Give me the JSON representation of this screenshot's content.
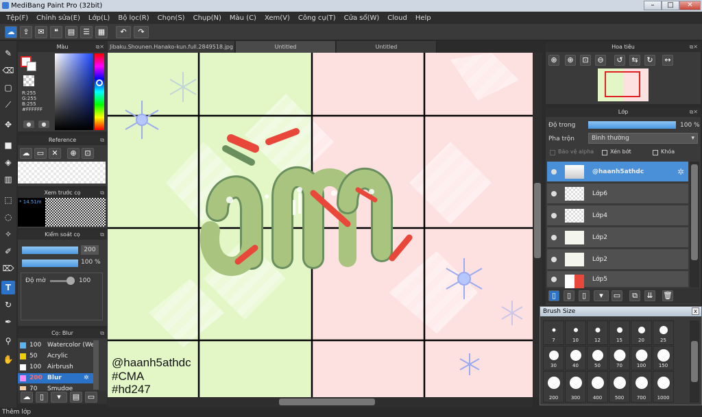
{
  "window": {
    "title": "MediBang Paint Pro (32bit)"
  },
  "menu": [
    "Tệp(F)",
    "Chỉnh sửa(E)",
    "Lớp(L)",
    "Bộ lọc(R)",
    "Chọn(S)",
    "Chụp(N)",
    "Màu (C)",
    "Xem(V)",
    "Công cụ(T)",
    "Cửa sổ(W)",
    "Cloud",
    "Help"
  ],
  "tabs": [
    "Jibaku.Shounen.Hanako-kun.full.2849518.jpg",
    "Untitled",
    "Untitled"
  ],
  "color_panel": {
    "title": "Màu",
    "r": "R:255",
    "g": "G:255",
    "b": "B:255",
    "hex": "#FFFFFF"
  },
  "reference_panel": {
    "title": "Reference"
  },
  "preview_panel": {
    "title": "Xem trước cọ",
    "size": "14.51m"
  },
  "brush_control": {
    "title": "Kiểm soát cọ",
    "size": "200",
    "opacity": "100 %",
    "blur_label": "Độ mờ",
    "blur_value": "100"
  },
  "brush_list": {
    "title": "Cọ: Blur",
    "items": [
      {
        "value": "100",
        "name": "Watercolor (We",
        "color": "#5ab4f0"
      },
      {
        "value": "50",
        "name": "Acrylic",
        "color": "#f0d000"
      },
      {
        "value": "100",
        "name": "Airbrush",
        "color": "#ffffff"
      },
      {
        "value": "200",
        "name": "Blur",
        "color": "#ff88ff"
      },
      {
        "value": "70",
        "name": "Smudge",
        "color": "#ffd0a0"
      }
    ]
  },
  "navigator": {
    "title": "Hoa tiêu"
  },
  "layers_panel": {
    "title": "Lớp",
    "opacity_label": "Độ trong",
    "opacity_value": "100 %",
    "opacity_level": 1.0,
    "blend_label": "Pha trộn",
    "blend_value": "Bình thường",
    "protect_alpha": "Bảo vệ alpha",
    "clipping": "Xén bớt",
    "lock": "Khóa",
    "layers": [
      {
        "name": "@haanh5athdc",
        "selected": true
      },
      {
        "name": "Lớp6",
        "selected": false
      },
      {
        "name": "Lớp4",
        "selected": false
      },
      {
        "name": "Lớp2",
        "selected": false
      },
      {
        "name": "Lớp2",
        "selected": false
      },
      {
        "name": "Lớp5",
        "selected": false
      }
    ]
  },
  "brush_size": {
    "title": "Brush Size",
    "sizes": [
      "7",
      "10",
      "12",
      "15",
      "20",
      "25",
      "30",
      "40",
      "50",
      "70",
      "100",
      "150",
      "200",
      "300",
      "400",
      "500",
      "700",
      "1000"
    ]
  },
  "canvas": {
    "title_text": "ấm",
    "signature": [
      "@haanh5athdc",
      "#CMA",
      "#hd247"
    ]
  },
  "status": {
    "text": "Thêm lớp"
  }
}
